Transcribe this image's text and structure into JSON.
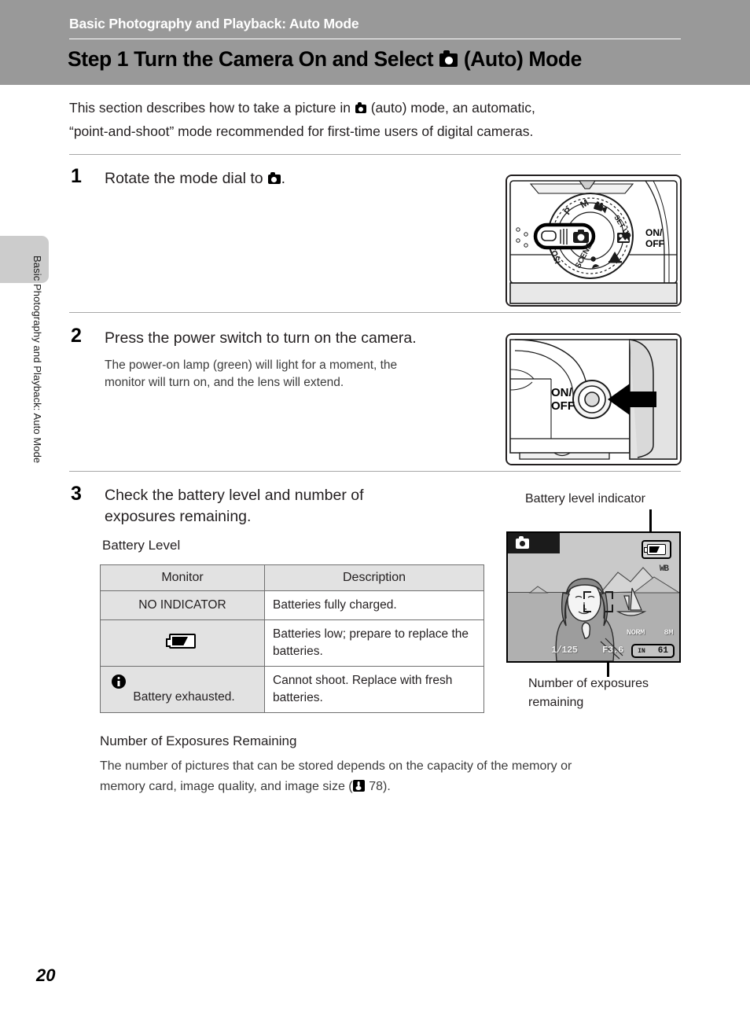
{
  "header": {
    "section_label": "Basic Photography and Playback: Auto Mode",
    "title_before_icon": "Step 1 Turn the Camera On and Select ",
    "title_icon": "auto-camera-icon",
    "title_after_icon": " (Auto) Mode",
    "band_color": "#999999"
  },
  "side_tab": {
    "running_head": "Basic Photography and Playback: Auto Mode",
    "tab_color": "#cccccc"
  },
  "intro": {
    "line1_before_icon": "This section describes how to take a picture in ",
    "line1_after_icon": " (auto) mode, an automatic,",
    "line2": "“point-and-shoot” mode recommended for first-time users of digital cameras."
  },
  "steps": [
    {
      "number": "1",
      "heading_before_icon": "Rotate the mode dial to ",
      "heading_after_icon": ".",
      "body": "",
      "illustration": "mode-dial-illustration",
      "dial_labels": [
        "P",
        "M",
        "SET UP",
        "SCENE",
        "ISO"
      ],
      "onoff_label_line1": "ON/",
      "onoff_label_line2": "OFF"
    },
    {
      "number": "2",
      "heading": "Press the power switch to turn on the camera.",
      "body_line1": "The power-on lamp (green) will light for a moment, the",
      "body_line2": "monitor will turn on, and the lens will extend.",
      "illustration": "power-switch-illustration",
      "onoff_label_line1": "ON/",
      "onoff_label_line2": "OFF"
    },
    {
      "number": "3",
      "heading_line1": "Check the battery level and number of",
      "heading_line2": "exposures remaining.",
      "subheading": "Battery Level"
    }
  ],
  "battery_table": {
    "columns": [
      "Monitor",
      "Description"
    ],
    "rows": [
      {
        "monitor_text": "NO INDICATOR",
        "monitor_icon": "",
        "description": "Batteries fully charged."
      },
      {
        "monitor_text": "",
        "monitor_icon": "low-battery-icon",
        "description": "Batteries low; prepare to replace the batteries."
      },
      {
        "monitor_text": "Battery exhausted.",
        "monitor_icon": "info-exclamation-icon",
        "description": "Cannot shoot. Replace with fresh batteries."
      }
    ]
  },
  "monitor_callouts": {
    "battery_label": "Battery level indicator",
    "exposures_label": "Number of exposures remaining"
  },
  "monitor_osd": {
    "mode_icon": "auto-camera-icon",
    "battery_icon": "low-battery-icon",
    "white_balance": "WB",
    "shutter_speed": "1/125",
    "aperture": "F3.6",
    "quality": "NORM",
    "image_size": "8M",
    "memory_label": "IN",
    "exposures_remaining": "61"
  },
  "exposures_section": {
    "heading": "Number of Exposures Remaining",
    "body_line1": "The number of pictures that can be stored depends on the capacity of the memory or",
    "body_line2_before_ref": "memory card, image quality, and image size (",
    "reference_page": " 78).",
    "reference_icon": "book-reference-icon"
  },
  "footer": {
    "page_number": "20"
  }
}
